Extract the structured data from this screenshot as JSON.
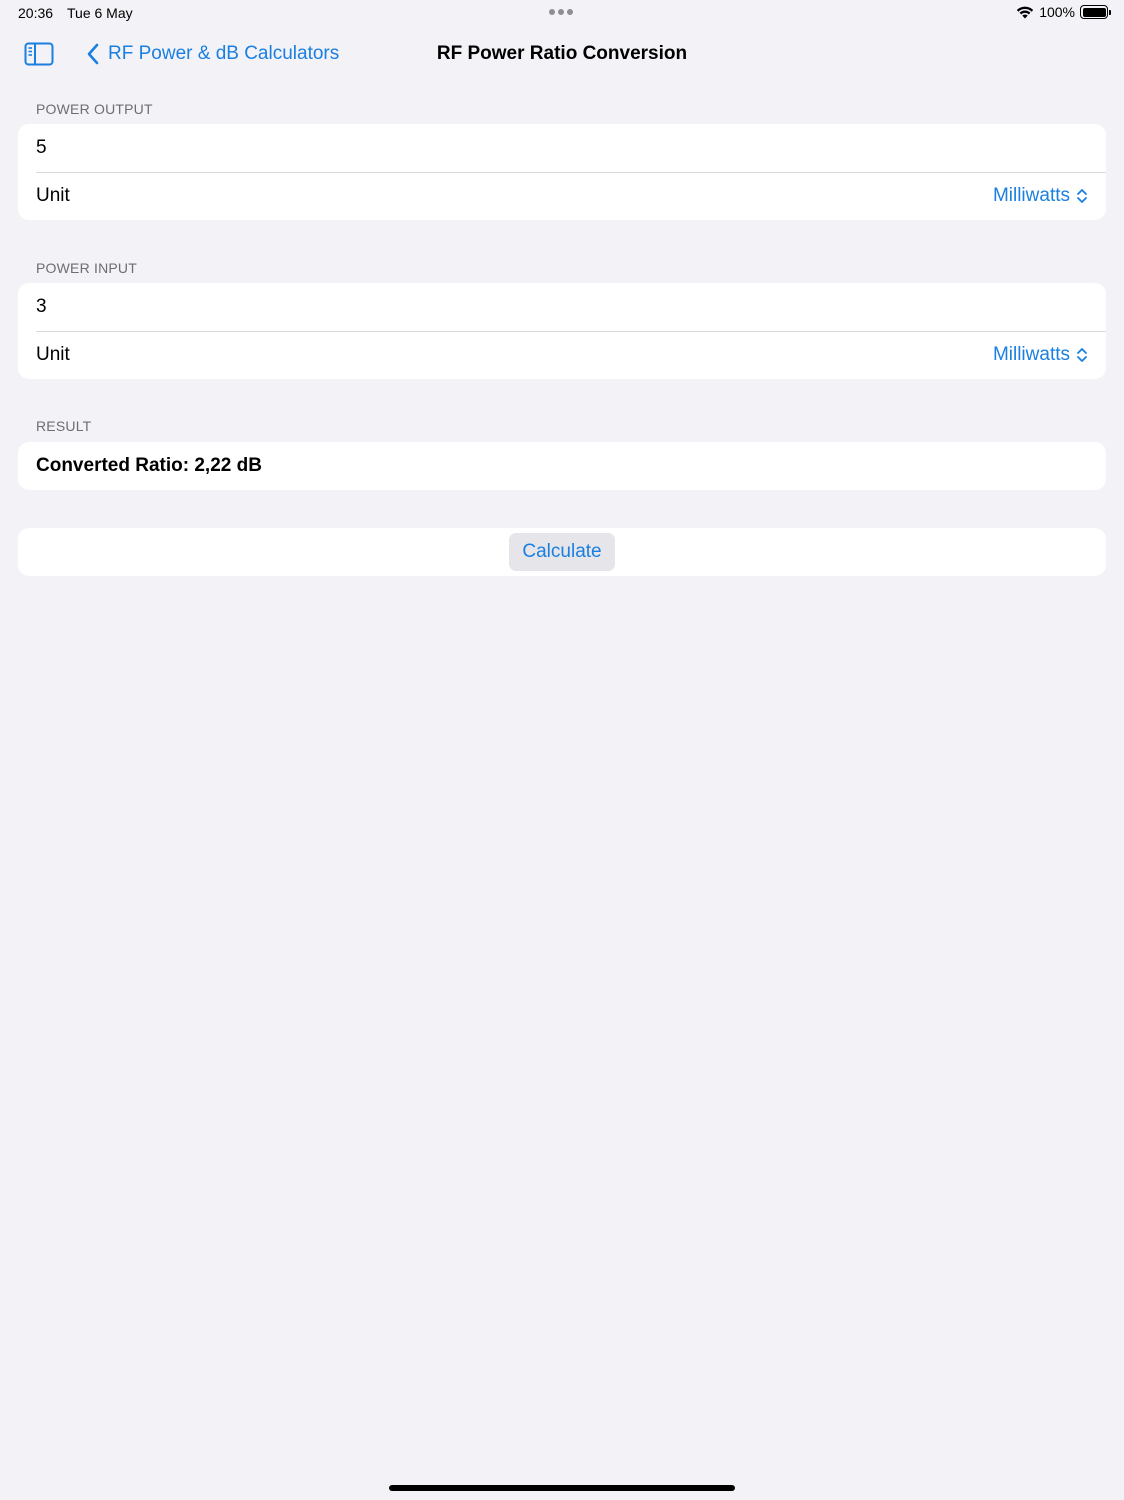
{
  "status_bar": {
    "time": "20:36",
    "date": "Tue 6 May",
    "battery": "100%",
    "wifi_icon": "wifi-icon",
    "battery_icon": "battery-full-icon"
  },
  "nav": {
    "back_label": "RF Power & dB Calculators",
    "title": "RF Power Ratio Conversion",
    "sidebar_icon": "sidebar-toggle-icon",
    "back_icon": "chevron-left-icon"
  },
  "power_output": {
    "header": "POWER OUTPUT",
    "value": "5",
    "unit_label": "Unit",
    "unit_value": "Milliwatts"
  },
  "power_input": {
    "header": "POWER INPUT",
    "value": "3",
    "unit_label": "Unit",
    "unit_value": "Milliwatts"
  },
  "result": {
    "header": "RESULT",
    "text": "Converted Ratio: 2,22 dB"
  },
  "actions": {
    "calculate_label": "Calculate"
  },
  "colors": {
    "accent": "#1a7fe0",
    "background": "#f2f2f7",
    "card": "#ffffff",
    "secondary_text": "#6d6d72"
  }
}
